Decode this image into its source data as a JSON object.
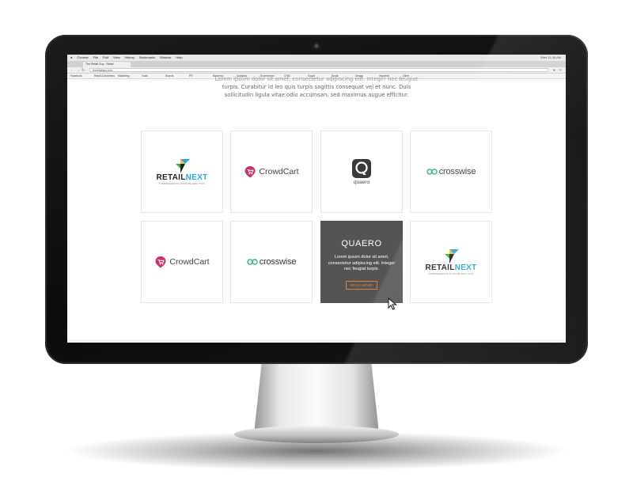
{
  "menubar": {
    "items": [
      "Chrome",
      "File",
      "Edit",
      "View",
      "History",
      "Bookmarks",
      "Window",
      "Help"
    ],
    "right": [
      "Wed 11:38 AM"
    ]
  },
  "browser": {
    "tab_title": "The Retail Guy - Retail",
    "url": "theretailguy.com",
    "bookmarks": [
      "Facebook",
      "Retail & Business",
      "Marketing",
      "Tools",
      "Brands",
      "PR",
      "Business",
      "Analytics",
      "Ecommerce",
      "CRM",
      "Social",
      "Email",
      "Design",
      "Imported",
      "Other"
    ]
  },
  "intro": {
    "line1": "Lorem ipsum dolor sit amet, consectetur adipiscing elit. Integer nec feugiat",
    "line2": "turpis. Curabitur id leo quis turpis sagittis consequat vel et nunc. Duis",
    "line3": "sollicitudin ligula vitae odio accumsan, sed maximus augue efficitur."
  },
  "logos": {
    "retailnext": {
      "part1": "RETAIL",
      "part2": "NEXT",
      "tagline": "COMPREHENSIVE IN-STORE ANALYTICS"
    },
    "crowdcart": {
      "name": "CrowdCart"
    },
    "quaero": {
      "name": "quaero"
    },
    "crosswise": {
      "name": "crosswise"
    }
  },
  "hover_card": {
    "title": "QUAERO",
    "text": "Lorem ipsum dolor sit amet, consectetur adipiscing elit. Integer nec feugiat turpis.",
    "button": "READ MORE"
  },
  "colors": {
    "accent_blue": "#2aa9d6",
    "crowdcart_pink": "#c8336b",
    "crosswise_green": "#3fb37f",
    "button_orange": "#e0803a",
    "hover_bg": "#545454"
  }
}
